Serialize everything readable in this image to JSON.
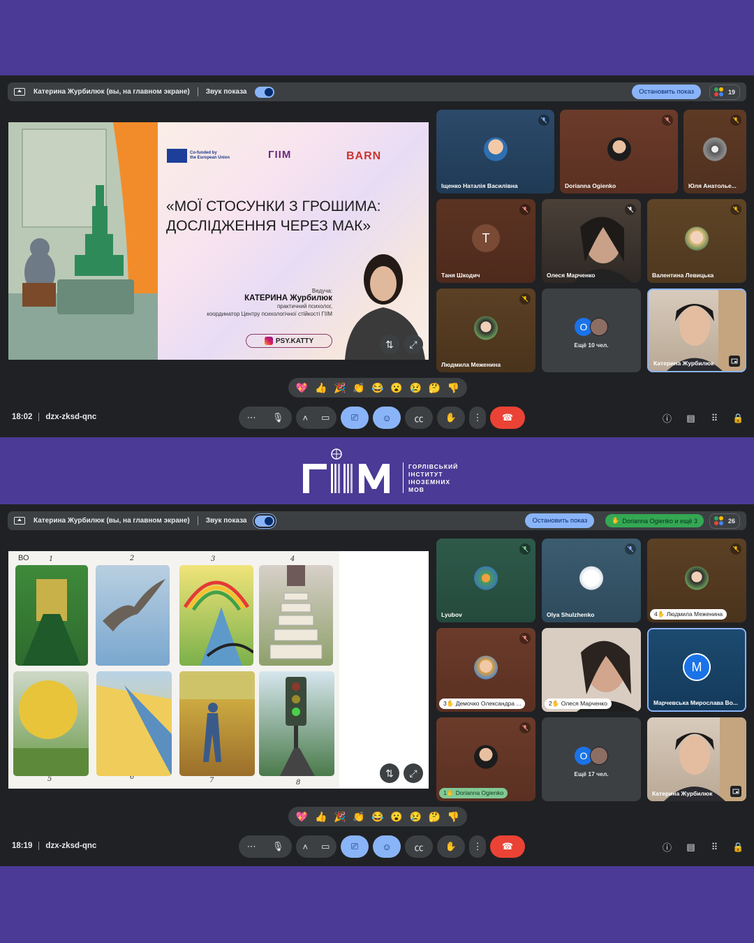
{
  "screen1": {
    "topbar": {
      "presenter": "Катерина Журбилюк (вы, на главном экране)",
      "sound_label": "Звук показа",
      "stop_button": "Остановить показ",
      "people_count": "19"
    },
    "slide": {
      "eu_text_1": "Co-funded by",
      "eu_text_2": "the European Union",
      "giim_logo": "ГІІМ",
      "barn_logo": "BARN",
      "title_line1": "«МОЇ СТОСУНКИ З ГРОШИМА:",
      "title_line2": "ДОСЛІДЖЕННЯ ЧЕРЕЗ МАК»",
      "lead_label": "Ведуча:",
      "lead_name": "КАТЕРИНА Журбилюк",
      "lead_role1": "практичний психолог,",
      "lead_role2": "координатор Центру психологічної стійкості ГІІМ",
      "instagram": "PSY.KATTY"
    },
    "tiles": [
      {
        "name": "Іщенко Наталія Василівна"
      },
      {
        "name": "Dorianna Ogienko"
      },
      {
        "name": "Юля Анатолье..."
      },
      {
        "name": "Таня Шкодич",
        "letter": "Т"
      },
      {
        "name": "Олеся Марченко"
      },
      {
        "name": "Валентина Левицька"
      },
      {
        "name": "Людмила Меженина"
      },
      {
        "name": "Ещё 10 чел.",
        "letter": "О"
      },
      {
        "name": "Катерина Журбилюк"
      }
    ],
    "time": "18:02",
    "meeting_code": "dzx-zksd-qnc"
  },
  "screen2": {
    "topbar": {
      "presenter": "Катерина Журбилюк (вы, на главном экране)",
      "sound_label": "Звук показа",
      "stop_button": "Остановить показ",
      "hand_raised": "Dorianna Ogienko и ещё 3",
      "people_count": "26"
    },
    "slide": {
      "corner_label": "ВО",
      "card_numbers": [
        "1",
        "2",
        "3",
        "4",
        "5",
        "6",
        "7",
        "8"
      ]
    },
    "tiles": [
      {
        "name": "Lyubov"
      },
      {
        "name": "Olya Shulzhenko"
      },
      {
        "name": "Людмила Меженина",
        "hand": "4"
      },
      {
        "name": "Демочко Олександра ...",
        "hand": "3"
      },
      {
        "name": "Олеся Марченко",
        "hand": "2"
      },
      {
        "name": "Марчевська Мирослава Во...",
        "letter": "M"
      },
      {
        "name": "Dorianna Ogienko",
        "hand": "1"
      },
      {
        "name": "Ещё 17 чел.",
        "letter": "О"
      },
      {
        "name": "Катерина Журбилюк"
      }
    ],
    "time": "18:19",
    "meeting_code": "dzx-zksd-qnc"
  },
  "reactions": [
    "💖",
    "👍",
    "🎉",
    "👏",
    "😂",
    "😮",
    "😢",
    "🤔",
    "👎"
  ],
  "brand": {
    "logo": "ГІІМ",
    "line1": "ГОРЛІВСЬКИЙ",
    "line2": "ІНСТИТУТ",
    "line3": "ІНОЗЕМНИХ",
    "line4": "МОВ"
  },
  "colors": {
    "background": "#4b3a96",
    "meet_dark": "#202124",
    "accent_blue": "#8ab4f8",
    "end_call_red": "#ea4335",
    "hand_green": "#34a853"
  }
}
